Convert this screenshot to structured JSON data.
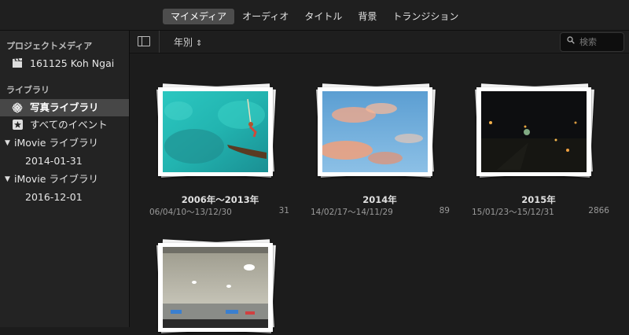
{
  "tabs": [
    "マイメディア",
    "オーディオ",
    "タイトル",
    "背景",
    "トランジション"
  ],
  "active_tab_index": 0,
  "sidebar": {
    "project_section": "プロジェクトメディア",
    "project_item": "161125 Koh Ngai",
    "library_section": "ライブラリ",
    "photos_library": "写真ライブラリ",
    "all_events": "すべてのイベント",
    "libraries": [
      {
        "name": "iMovie ライブラリ",
        "child": "2014-01-31"
      },
      {
        "name": "iMovie ライブラリ",
        "child": "2016-12-01"
      }
    ]
  },
  "toolbar": {
    "sort_label": "年別",
    "search_placeholder": "検索"
  },
  "events": [
    {
      "title": "2006年〜2013年",
      "dates": "06/04/10〜13/12/30",
      "count": "31"
    },
    {
      "title": "2014年",
      "dates": "14/02/17〜14/11/29",
      "count": "89"
    },
    {
      "title": "2015年",
      "dates": "15/01/23〜15/12/31",
      "count": "2866"
    },
    {
      "title": "",
      "dates": "",
      "count": ""
    }
  ],
  "colors": {
    "background": "#1c1c1c",
    "sidebar": "#232323",
    "selection": "#474747",
    "active_tab": "#4d4d4d"
  }
}
